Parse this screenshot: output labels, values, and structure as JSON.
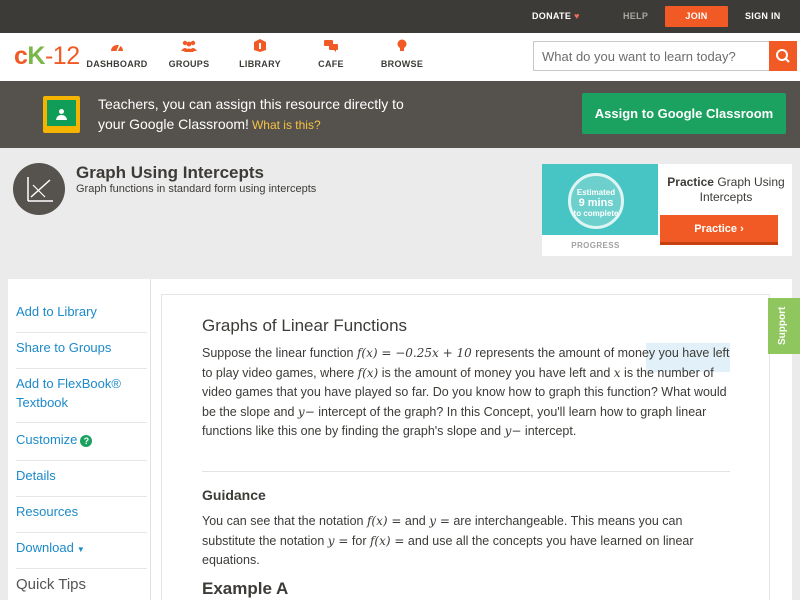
{
  "topbar": {
    "donate": "DONATE",
    "help": "HELP",
    "join": "JOIN",
    "signin": "SIGN IN"
  },
  "logo": {
    "c": "c",
    "k": "K",
    "n": "-12"
  },
  "nav": {
    "items": [
      {
        "label": "DASHBOARD",
        "icon": "dashboard-icon"
      },
      {
        "label": "GROUPS",
        "icon": "groups-icon"
      },
      {
        "label": "LIBRARY",
        "icon": "library-icon"
      },
      {
        "label": "CAFE",
        "icon": "cafe-icon"
      },
      {
        "label": "BROWSE",
        "icon": "browse-icon"
      }
    ],
    "search_placeholder": "What do you want to learn today?"
  },
  "teacher_banner": {
    "line1": "Teachers, you can assign this resource directly to",
    "line2": "your Google Classroom!",
    "what_is_this": "What is this?",
    "assign_button": "Assign to Google Classroom"
  },
  "concept": {
    "title": "Graph Using Intercepts",
    "subtitle": "Graph functions in standard form using intercepts"
  },
  "practice": {
    "estimated": "Estimated",
    "mins": "9 mins",
    "to_complete": "to complete",
    "progress_label": "PROGRESS",
    "heading_bold": "Practice",
    "heading_rest": "Graph Using Intercepts",
    "button": "Practice"
  },
  "sidebar": {
    "items": [
      {
        "label": "Add to Library"
      },
      {
        "label": "Share to Groups"
      },
      {
        "label": "Add to FlexBook® Textbook"
      },
      {
        "label": "Customize"
      },
      {
        "label": "Details"
      },
      {
        "label": "Resources"
      },
      {
        "label": "Download"
      }
    ],
    "quick_tips": "Quick Tips"
  },
  "article": {
    "title": "Graphs of Linear Functions",
    "p1_a": "Suppose the linear function ",
    "p1_math1": "f(x) = −0.25x + 10",
    "p1_b": " represents the amount of money you have left to play video games, where ",
    "p1_math2": "f(x)",
    "p1_c": " is the amount of money you have left and ",
    "p1_math3": "x",
    "p1_d": " is the number of video games that you have played so far. Do you know how to graph this function? What would be the slope and ",
    "p1_math4": "y−",
    "p1_e": " intercept of the graph? In this Concept, you'll learn how to graph linear functions like this one by finding the graph's slope and ",
    "p1_math5": "y−",
    "p1_f": " intercept.",
    "guidance_heading": "Guidance",
    "g_a": "You can see that the notation ",
    "g_math1": "f(x) =",
    "g_b": " and ",
    "g_math2": "y =",
    "g_c": " are interchangeable. This means you can substitute the notation ",
    "g_math3": "y =",
    "g_d": " for ",
    "g_math4": "f(x) =",
    "g_e": " and use all the concepts you have learned on linear equations.",
    "example_heading": "Example A"
  },
  "support": "Support"
}
